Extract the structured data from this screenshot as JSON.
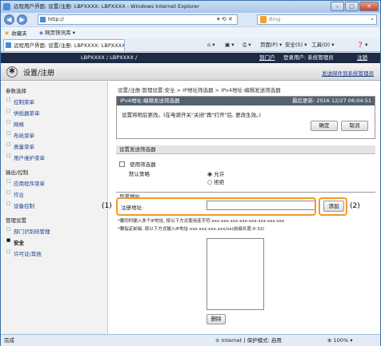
{
  "window": {
    "title": "远程用户界面: 设置/注册: LBPXXXX: LBPXXXX - Windows Internet Explorer",
    "buttons": {
      "minimize": "–",
      "maximize": "□",
      "close": "✕"
    }
  },
  "addressbar": {
    "url": "http://",
    "back_glyph": "◀",
    "forward_glyph": "▶",
    "search_placeholder": "Bing",
    "controls": "▾ ⟲ ✕"
  },
  "favorites": {
    "label": "收藏夹",
    "item": "网页快讯库 ▾"
  },
  "tab": {
    "label": "远程用户界面: 设置/注册: LBPXXXX: LBPXXXX"
  },
  "commandbar": {
    "items": [
      "▾",
      "▾",
      "▾",
      "页面(P) ▾",
      "安全(S) ▾",
      "工具(O) ▾",
      "❓ ▾"
    ]
  },
  "app_header": {
    "device": "LBPXXXX / LBPXXXX /",
    "portal": "到门户",
    "login_user": "登录用户: 系统管理员",
    "logout": "注销",
    "page_title": "设置/注册",
    "mail_admin": "发送邮件到系统管理员"
  },
  "sidebar": {
    "sections": [
      {
        "heading": "参数选择",
        "items": [
          "控制菜单",
          "供纸器菜单",
          "网络",
          "布局菜单",
          "质量菜单",
          "用户维护菜单"
        ]
      },
      {
        "heading": "输出/控制",
        "items": [
          "应用程序菜单",
          "作业",
          "设备控制"
        ]
      },
      {
        "heading": "管理设置",
        "items": [
          "部门识别码管理",
          "安全",
          "许可证/其他"
        ]
      }
    ],
    "active_item": "安全"
  },
  "breadcrumb": "设置/注册:管理设置:安全 > IP地址筛选器 > IPv4地址:编辑发送筛选器",
  "dialog": {
    "title": "IPv4地址:编辑发送筛选器",
    "last_updated": "最后更新: 2016 12/27 06:04:51",
    "message": "设置将稍后更改。(在电源开关\"关闭\"再\"打开\"后, 更改生效。)",
    "ok": "确定",
    "cancel": "取消"
  },
  "filter_section": {
    "heading": "设置发送筛选器",
    "use_filter_label": "使用筛选器",
    "use_filter_checked": false,
    "default_policy_label": "默认策略",
    "options": [
      "允许",
      "拒绝"
    ],
    "selected": "允许"
  },
  "exception_section": {
    "heading": "异常地址",
    "register_label": "注册地址:",
    "register_value": "",
    "add_button": "添加",
    "note1": "*要同时输入多个IP地址, 按以下方式使用连字符:xxx.xxx.xxx.xxx-xxx.xxx.xxx.xxx",
    "note2": "*要指定前缀, 按以下方式输入IP地址:xxx.xxx.xxx.xxx/xx(前缀长度:0-32)",
    "delete_button": "删除"
  },
  "callouts": {
    "one": "(1)",
    "two": "(2)"
  },
  "statusbar": {
    "left": "完成",
    "zone": "Internet | 保护模式: 启用",
    "zoom": "100%"
  },
  "colors": {
    "accent_orange": "#f09a2a",
    "header_dark": "#1e2b44",
    "ie_blue": "#3a6ea5"
  }
}
